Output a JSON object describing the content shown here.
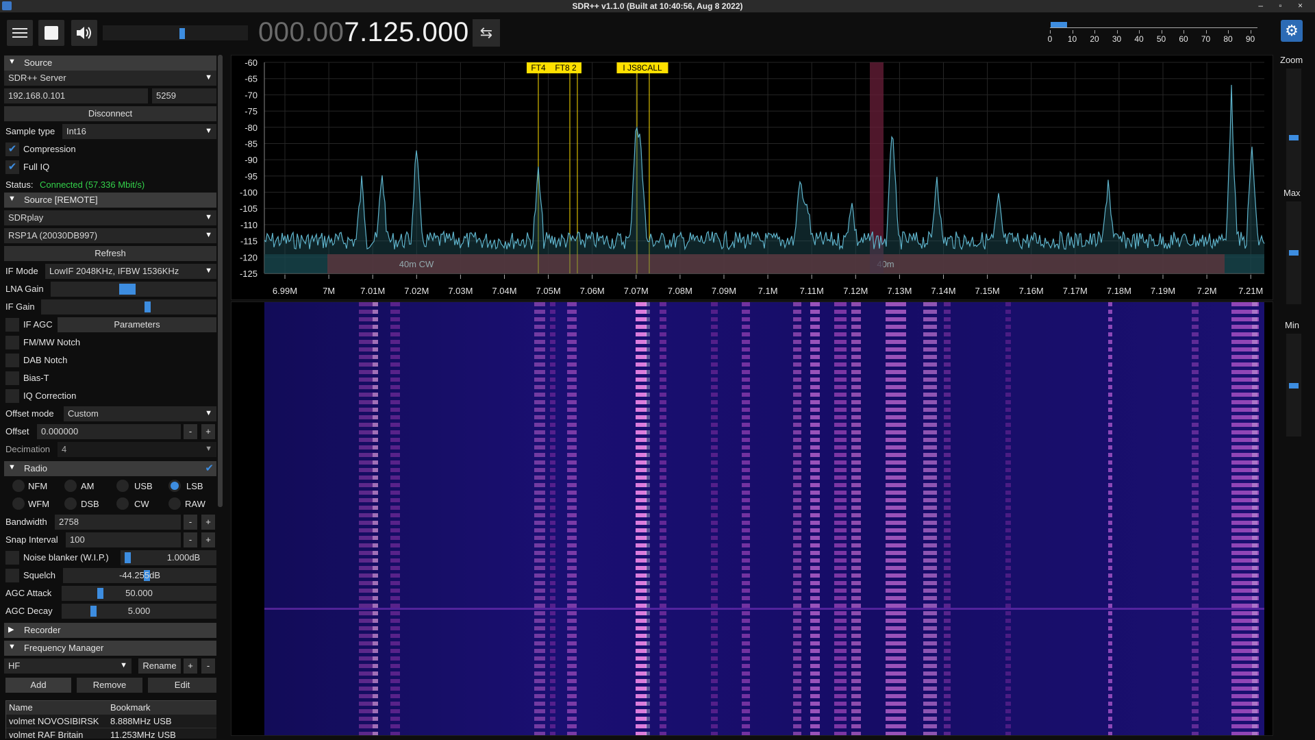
{
  "window": {
    "title": "SDR++ v1.1.0 (Built at 10:40:56, Aug  8 2022)",
    "controls": "– ▫ ×"
  },
  "toolbar": {
    "frequency_dim": "000.00",
    "frequency_bright": "7.125.000",
    "swap_glyph": "⇆",
    "snr_ticks": [
      "0",
      "10",
      "20",
      "30",
      "40",
      "50",
      "60",
      "70",
      "80",
      "90"
    ],
    "snr_level": 0.08
  },
  "right": {
    "zoom": "Zoom",
    "max": "Max",
    "min": "Min",
    "zoom_level": 0.2,
    "max_level": 0.4,
    "min_level": 0.4
  },
  "source": {
    "header": "Source",
    "type": "SDR++ Server",
    "host": "192.168.0.101",
    "port": "5259",
    "disconnect": "Disconnect",
    "sample_type_label": "Sample type",
    "sample_type": "Int16",
    "compression": "Compression",
    "full_iq": "Full IQ",
    "status_label": "Status:",
    "status_value": "Connected (57.336 Mbit/s)"
  },
  "remote": {
    "header": "Source [REMOTE]",
    "device_type": "SDRplay",
    "device": "RSP1A (20030DB997)",
    "refresh": "Refresh",
    "if_mode_label": "IF Mode",
    "if_mode": "LowIF 2048KHz, IFBW 1536KHz",
    "lna_gain": "LNA Gain",
    "if_gain": "IF Gain",
    "if_agc": "IF AGC",
    "parameters": "Parameters",
    "fm_notch": "FM/MW Notch",
    "dab_notch": "DAB Notch",
    "bias_t": "Bias-T",
    "iq_correction": "IQ Correction",
    "offset_mode_label": "Offset mode",
    "offset_mode": "Custom",
    "offset_label": "Offset",
    "offset": "0.000000",
    "decimation_label": "Decimation",
    "decimation": "4"
  },
  "radio": {
    "header": "Radio",
    "modes": [
      "NFM",
      "AM",
      "USB",
      "LSB",
      "WFM",
      "DSB",
      "CW",
      "RAW"
    ],
    "selected": "LSB",
    "bandwidth_label": "Bandwidth",
    "bandwidth": "2758",
    "snap_label": "Snap Interval",
    "snap": "100",
    "noise_blanker": "Noise blanker (W.I.P.)",
    "noise_blanker_value": "1.000dB",
    "squelch": "Squelch",
    "squelch_value": "-44.255dB",
    "agc_attack": "AGC Attack",
    "agc_attack_value": "50.000",
    "agc_decay": "AGC Decay",
    "agc_decay_value": "5.000"
  },
  "recorder": {
    "header": "Recorder"
  },
  "freqmgr": {
    "header": "Frequency Manager",
    "list": "HF",
    "rename": "Rename",
    "plus": "+",
    "minus": "-",
    "add": "Add",
    "remove": "Remove",
    "edit": "Edit",
    "col_name": "Name",
    "col_bookmark": "Bookmark",
    "rows": [
      {
        "name": "volmet NOVOSIBIRSK",
        "bookmark": "8.888MHz USB"
      },
      {
        "name": "volmet RAF Britain",
        "bookmark": "11.253MHz USB"
      }
    ]
  },
  "spectrum": {
    "y_ticks": [
      "-60",
      "-65",
      "-70",
      "-75",
      "-80",
      "-85",
      "-90",
      "-95",
      "-100",
      "-105",
      "-110",
      "-115",
      "-120",
      "-125"
    ],
    "x_ticks": [
      "6.99M",
      "7M",
      "7.01M",
      "7.02M",
      "7.03M",
      "7.04M",
      "7.05M",
      "7.06M",
      "7.07M",
      "7.08M",
      "7.09M",
      "7.1M",
      "7.11M",
      "7.12M",
      "7.13M",
      "7.14M",
      "7.15M",
      "7.16M",
      "7.17M",
      "7.18M",
      "7.19M",
      "7.2M",
      "7.21M"
    ],
    "markers": [
      "FT4",
      "FT8 2",
      "I JS8CALL"
    ],
    "bands": [
      "40m CW",
      "40m"
    ]
  },
  "colors": {
    "accent": "#3d8de0",
    "trace": "#5fb4cc",
    "band": "#8a1f26",
    "marker": "#ffe000",
    "status_ok": "#33d24a"
  }
}
